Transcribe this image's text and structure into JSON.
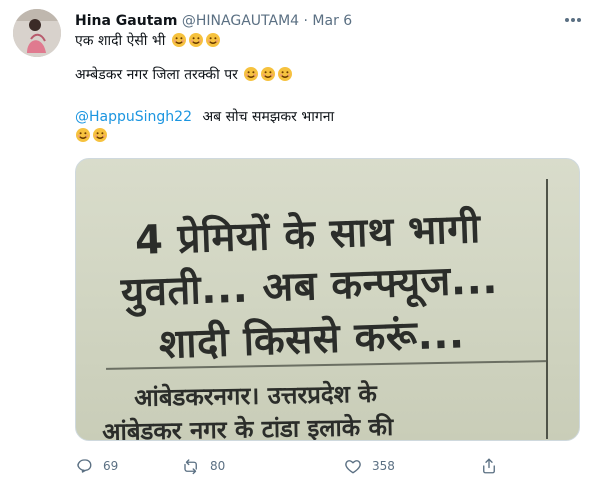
{
  "tweet": {
    "author_name": "Hina Gautam",
    "author_handle": "@HINAGAUTAM4",
    "dot": "·",
    "date": "Mar 6",
    "line1": "एक शादी ऐसी भी",
    "line2": "अम्बेडकर नगर जिला तरक्की पर",
    "mention": "@HappuSingh22",
    "line3_after_mention": "अब सोच समझकर भागना"
  },
  "media": {
    "headline_line1": "4 प्रेमियों के साथ भागी",
    "headline_line2": "युवती... अब कन्फ्यूज...",
    "headline_line3": "शादी किससे करूं...",
    "body_line1": "आंबेडकरनगर। उत्तरप्रदेश के",
    "body_line2": "आंबेडकर नगर के टांडा इलाके की"
  },
  "actions": {
    "reply_count": "69",
    "retweet_count": "80",
    "like_count": "358"
  },
  "colors": {
    "link": "#1b95e0",
    "secondary_text": "#5b7083",
    "emoji": "#f6c23e"
  }
}
